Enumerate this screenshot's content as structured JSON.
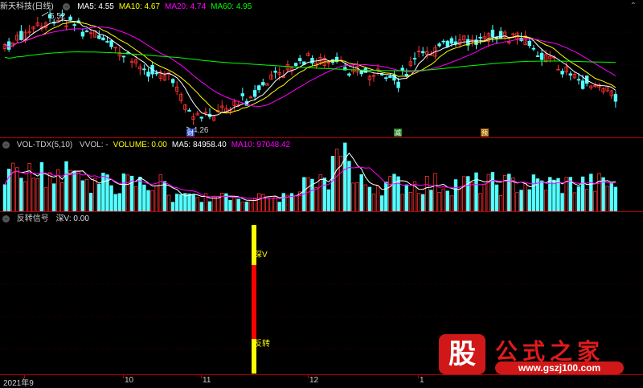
{
  "main_chart": {
    "title": "新天科技(日线)",
    "indicators": [
      {
        "label": "MA5: 4.55",
        "color": "#ffffff"
      },
      {
        "label": "MA10: 4.67",
        "color": "#ffff00"
      },
      {
        "label": "MA20: 4.74",
        "color": "#ff00ff"
      },
      {
        "label": "MA60: 4.95",
        "color": "#00ff00"
      }
    ],
    "high_label": "5.52",
    "low_label": "4.26",
    "event_markers": [
      "减",
      "预"
    ],
    "expand_icon": "expand-arrow-icon"
  },
  "volume_panel": {
    "title": "VOL-TDX(5,10)",
    "fields": [
      {
        "label": "VVOL: -",
        "color": "#cccccc"
      },
      {
        "label": "VOLUME: 0.00",
        "color": "#ffff00"
      },
      {
        "label": "MA5: 84958.40",
        "color": "#ffffff"
      },
      {
        "label": "MA10: 97048.42",
        "color": "#ff00ff"
      }
    ]
  },
  "signal_panel": {
    "title": "反转信号",
    "field": "深V: 0.00",
    "bar_labels": [
      "深V",
      "反转"
    ]
  },
  "axis": {
    "ticks": [
      "2021年9",
      "10",
      "11",
      "12",
      "1"
    ]
  },
  "logo": {
    "badge": "股",
    "title": "公式之家",
    "url": "www.gszj100.com"
  },
  "colors": {
    "up": "#ff3232",
    "down": "#54ffff",
    "ma5": "#ffffff",
    "ma10": "#ffff00",
    "ma20": "#ff00ff",
    "ma60": "#00ff00",
    "signal_red": "#ff0000",
    "signal_yellow": "#ffff00"
  }
}
